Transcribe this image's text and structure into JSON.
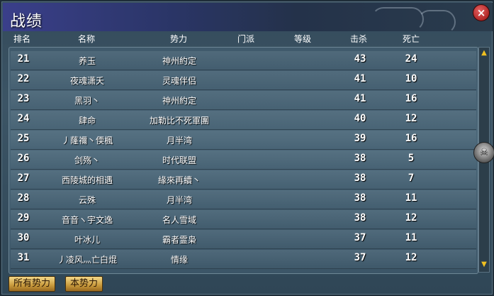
{
  "window": {
    "title": "战绩",
    "close_label": "×"
  },
  "columns": [
    "排名",
    "名称",
    "势力",
    "门派",
    "等级",
    "击杀",
    "死亡"
  ],
  "rows": [
    {
      "rank": "21",
      "name": "养玉",
      "faction": "神州約定",
      "sect": "",
      "level": "",
      "kills": "43",
      "deaths": "24"
    },
    {
      "rank": "22",
      "name": "夜魂潇夭",
      "faction": "灵魂伴侣",
      "sect": "",
      "level": "",
      "kills": "41",
      "deaths": "10"
    },
    {
      "rank": "23",
      "name": "黑羽丶",
      "faction": "神州約定",
      "sect": "",
      "level": "",
      "kills": "41",
      "deaths": "16"
    },
    {
      "rank": "24",
      "name": "肆命",
      "faction": "加勒比不死軍團",
      "sect": "",
      "level": "",
      "kills": "40",
      "deaths": "12"
    },
    {
      "rank": "25",
      "name": "丿蕯禰丶偄楓",
      "faction": "月半湾",
      "sect": "",
      "level": "",
      "kills": "39",
      "deaths": "16"
    },
    {
      "rank": "26",
      "name": "剑殇丶",
      "faction": "时代联盟",
      "sect": "",
      "level": "",
      "kills": "38",
      "deaths": "5"
    },
    {
      "rank": "27",
      "name": "西陵城的相遇",
      "faction": "緣來再續丶",
      "sect": "",
      "level": "",
      "kills": "38",
      "deaths": "7"
    },
    {
      "rank": "28",
      "name": "云殊",
      "faction": "月半湾",
      "sect": "",
      "level": "",
      "kills": "38",
      "deaths": "11"
    },
    {
      "rank": "29",
      "name": "音音ヽ宇文逸",
      "faction": "名人雪域",
      "sect": "",
      "level": "",
      "kills": "38",
      "deaths": "12"
    },
    {
      "rank": "30",
      "name": "叶冰儿",
      "faction": "霸者霊枭",
      "sect": "",
      "level": "",
      "kills": "37",
      "deaths": "11"
    },
    {
      "rank": "31",
      "name": "丿凌风灬亡白焜",
      "faction": "情缘",
      "sect": "",
      "level": "",
      "kills": "37",
      "deaths": "12"
    }
  ],
  "scroll": {
    "up_icon": "triangle-up-icon",
    "down_icon": "triangle-down-icon",
    "up_glyph": "▲",
    "down_glyph": "▼"
  },
  "skull_icon": {
    "glyph": "☠"
  },
  "tabs": [
    {
      "label": "所有势力"
    },
    {
      "label": "本势力"
    }
  ],
  "colors": {
    "accent": "#f0c020",
    "close": "#c02020",
    "text": "#ffffff"
  }
}
